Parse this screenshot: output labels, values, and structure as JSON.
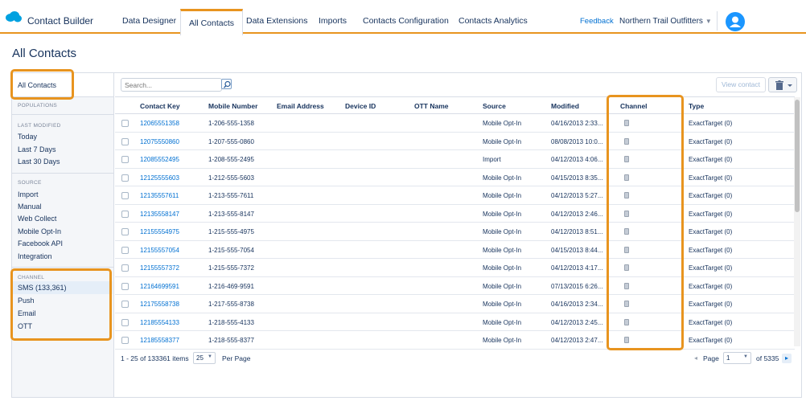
{
  "app": {
    "name": "Contact Builder"
  },
  "nav": {
    "tabs": [
      {
        "label": "Data Designer"
      },
      {
        "label": "All Contacts"
      },
      {
        "label": "Data Extensions"
      },
      {
        "label": "Imports"
      },
      {
        "label": "Contacts Configuration"
      },
      {
        "label": "Contacts Analytics"
      }
    ],
    "feedback": "Feedback",
    "org": "Northern Trail Outfitters"
  },
  "page": {
    "title": "All Contacts"
  },
  "sidebar": {
    "all_contacts": "All Contacts",
    "populations_header": "POPULATIONS",
    "last_modified_header": "LAST MODIFIED",
    "last_modified_items": [
      "Today",
      "Last 7 Days",
      "Last 30 Days"
    ],
    "source_header": "SOURCE",
    "source_items": [
      "Import",
      "Manual",
      "Web Collect",
      "Mobile Opt-In",
      "Facebook API",
      "Integration"
    ],
    "channel_header": "CHANNEL",
    "channel_items": [
      "SMS  (133,361)",
      "Push",
      "Email",
      "OTT"
    ]
  },
  "toolbar": {
    "search_placeholder": "Search...",
    "view_contact": "View contact"
  },
  "table": {
    "columns": [
      "Contact Key",
      "Mobile Number",
      "Email Address",
      "Device ID",
      "OTT Name",
      "Source",
      "Modified",
      "Channel",
      "Type"
    ],
    "rows": [
      {
        "key": "12065551358",
        "mobile": "1-206-555-1358",
        "source": "Mobile Opt-In",
        "modified": "04/16/2013 2:33...",
        "type": "ExactTarget (0)"
      },
      {
        "key": "12075550860",
        "mobile": "1-207-555-0860",
        "source": "Mobile Opt-In",
        "modified": "08/08/2013 10:0...",
        "type": "ExactTarget (0)"
      },
      {
        "key": "12085552495",
        "mobile": "1-208-555-2495",
        "source": "Import",
        "modified": "04/12/2013 4:06...",
        "type": "ExactTarget (0)"
      },
      {
        "key": "12125555603",
        "mobile": "1-212-555-5603",
        "source": "Mobile Opt-In",
        "modified": "04/15/2013 8:35...",
        "type": "ExactTarget (0)"
      },
      {
        "key": "12135557611",
        "mobile": "1-213-555-7611",
        "source": "Mobile Opt-In",
        "modified": "04/12/2013 5:27...",
        "type": "ExactTarget (0)"
      },
      {
        "key": "12135558147",
        "mobile": "1-213-555-8147",
        "source": "Mobile Opt-In",
        "modified": "04/12/2013 2:46...",
        "type": "ExactTarget (0)"
      },
      {
        "key": "12155554975",
        "mobile": "1-215-555-4975",
        "source": "Mobile Opt-In",
        "modified": "04/12/2013 8:51...",
        "type": "ExactTarget (0)"
      },
      {
        "key": "12155557054",
        "mobile": "1-215-555-7054",
        "source": "Mobile Opt-In",
        "modified": "04/15/2013 8:44...",
        "type": "ExactTarget (0)"
      },
      {
        "key": "12155557372",
        "mobile": "1-215-555-7372",
        "source": "Mobile Opt-In",
        "modified": "04/12/2013 4:17...",
        "type": "ExactTarget (0)"
      },
      {
        "key": "12164699591",
        "mobile": "1-216-469-9591",
        "source": "Mobile Opt-In",
        "modified": "07/13/2015 6:26...",
        "type": "ExactTarget (0)"
      },
      {
        "key": "12175558738",
        "mobile": "1-217-555-8738",
        "source": "Mobile Opt-In",
        "modified": "04/16/2013 2:34...",
        "type": "ExactTarget (0)"
      },
      {
        "key": "12185554133",
        "mobile": "1-218-555-4133",
        "source": "Mobile Opt-In",
        "modified": "04/12/2013 2:45...",
        "type": "ExactTarget (0)"
      },
      {
        "key": "12185558377",
        "mobile": "1-218-555-8377",
        "source": "Mobile Opt-In",
        "modified": "04/12/2013 2:47...",
        "type": "ExactTarget (0)"
      }
    ]
  },
  "footer": {
    "range": "1 - 25 of 133361 items",
    "per_page_value": "25",
    "per_page_label": "Per Page",
    "page_label": "Page",
    "page_value": "1",
    "of_pages": "of 5335"
  },
  "colors": {
    "accent": "#e8941f",
    "link": "#0070d2",
    "brand": "#00a1e0"
  },
  "icons": {
    "logo": "salesforce-cloud-icon",
    "avatar": "user-avatar-icon",
    "search": "search-icon",
    "trash": "trash-icon",
    "channel": "mobile-device-icon"
  }
}
